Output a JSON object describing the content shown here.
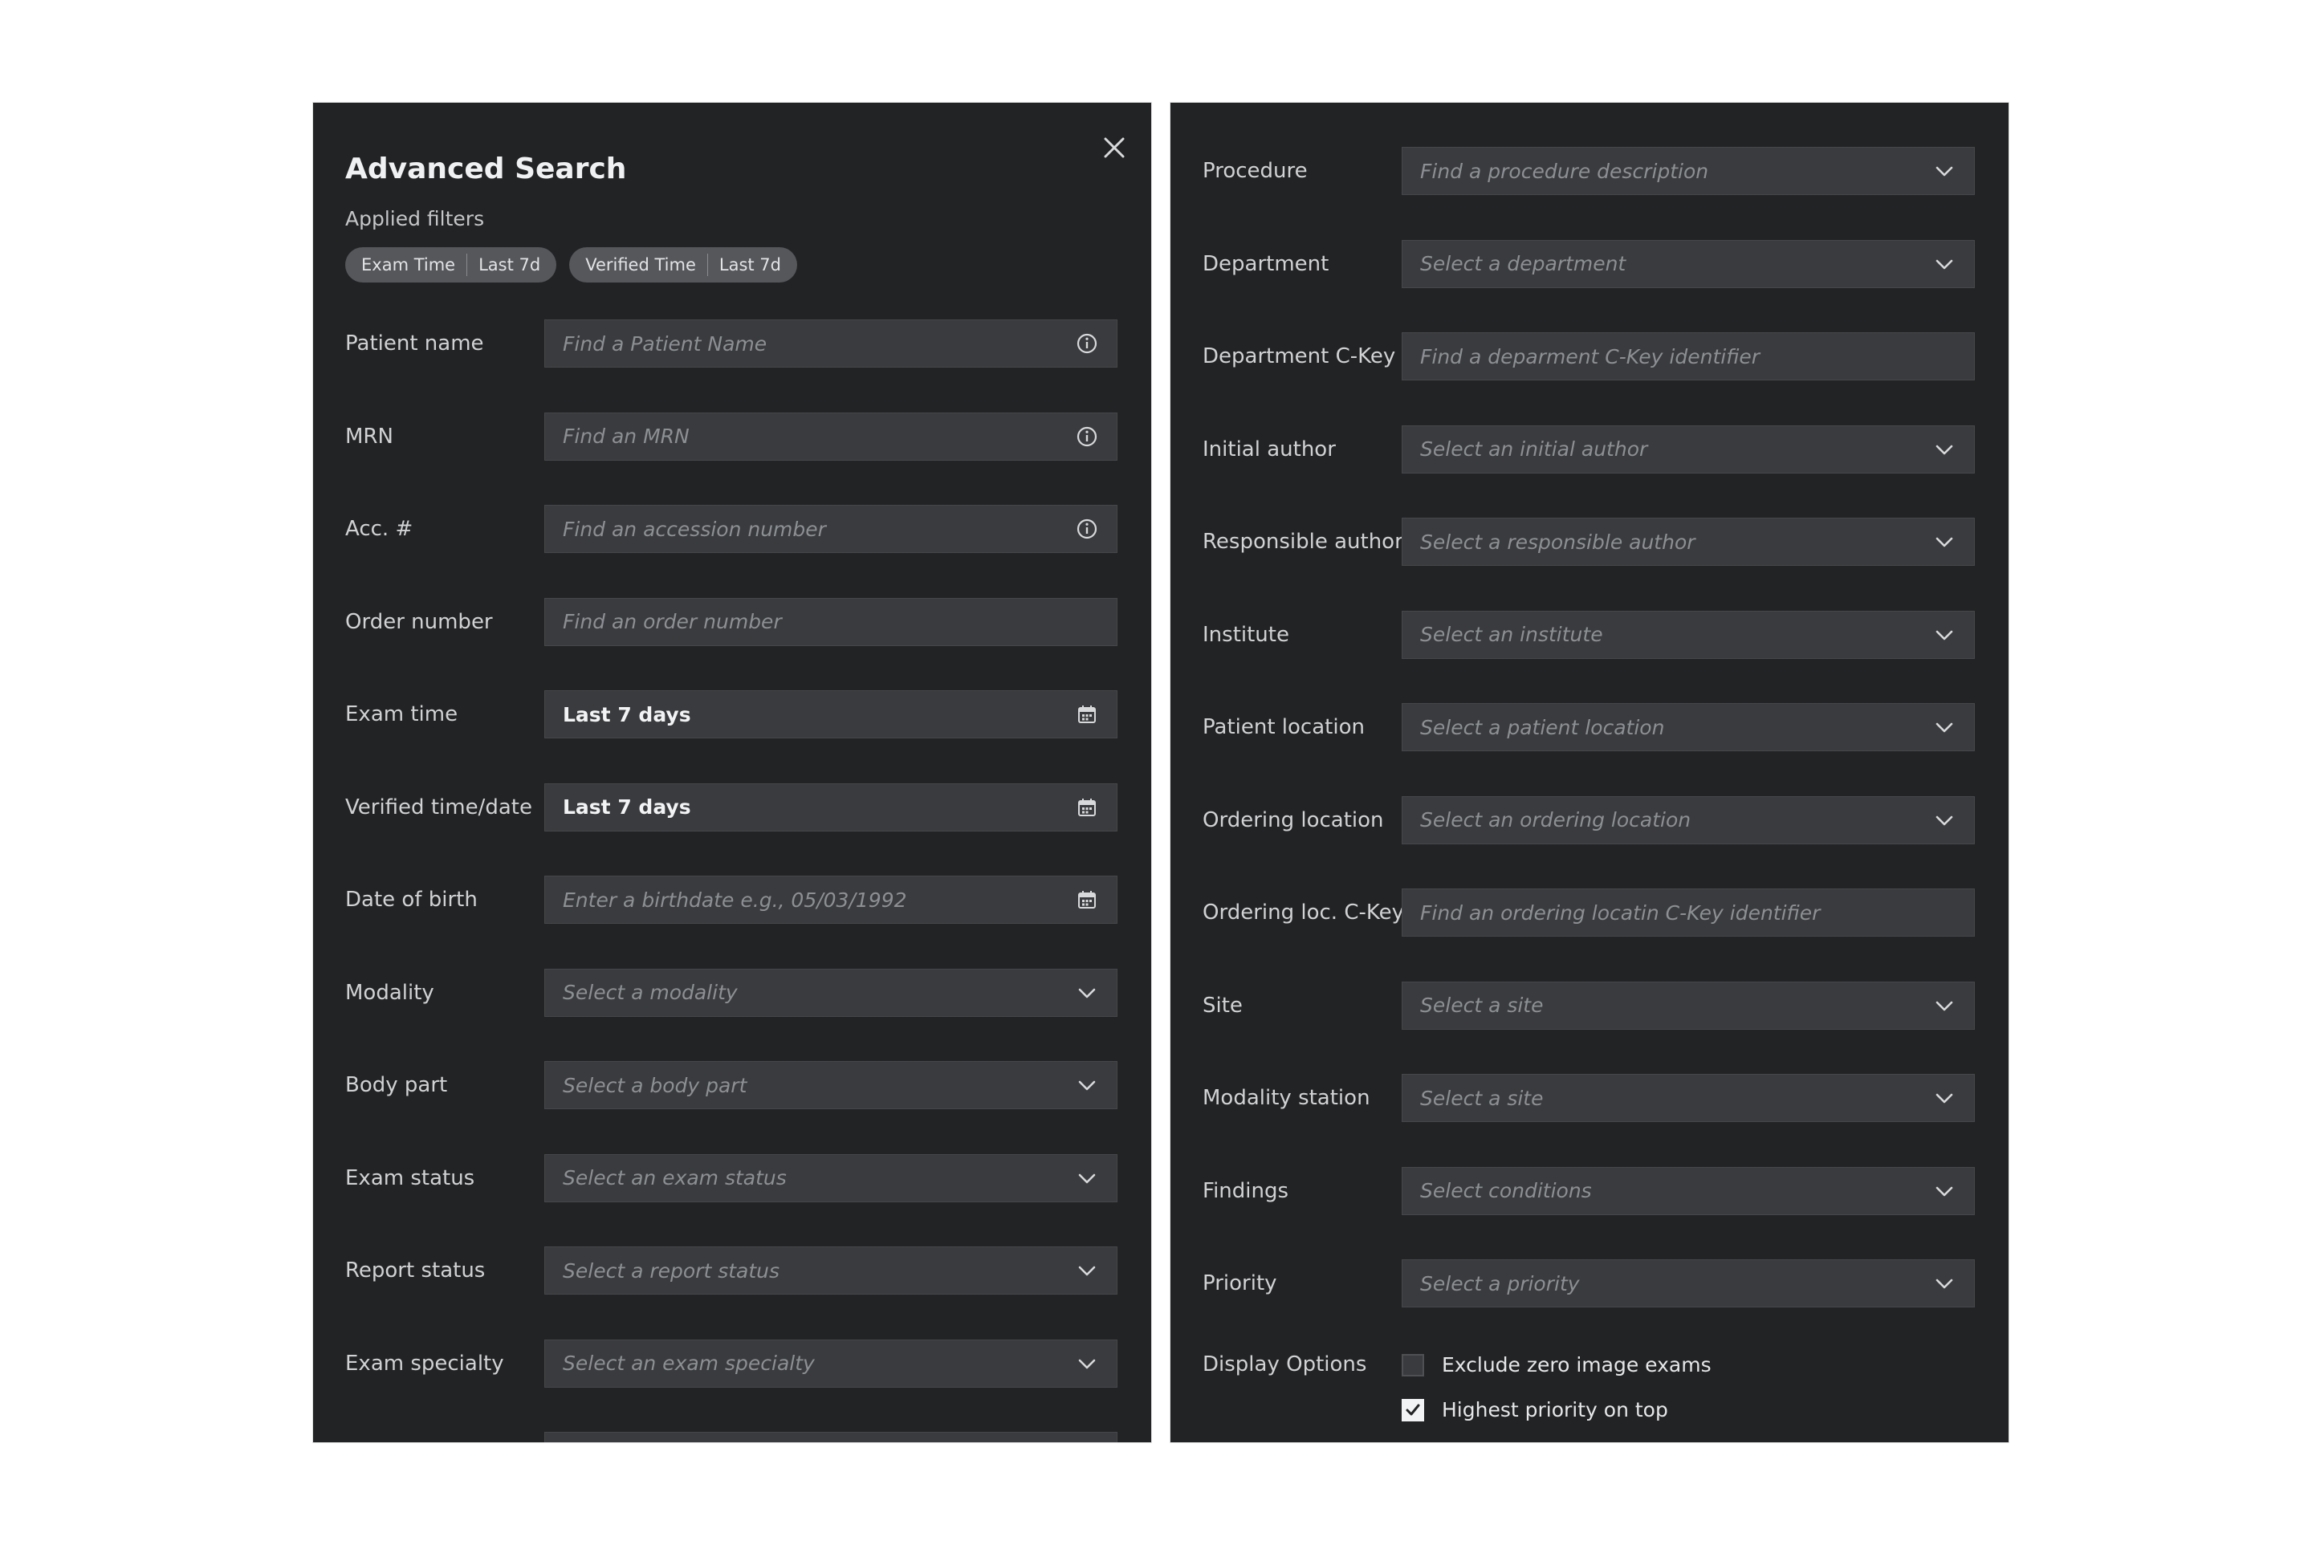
{
  "left_panel": {
    "title": "Advanced Search",
    "applied_filters_label": "Applied filters",
    "chips": [
      {
        "name": "Exam Time",
        "value": "Last 7d"
      },
      {
        "name": "Verified Time",
        "value": "Last 7d"
      }
    ],
    "fields": [
      {
        "label": "Patient name",
        "placeholder": "Find a Patient Name",
        "value": "",
        "icon": "info-icon"
      },
      {
        "label": "MRN",
        "placeholder": "Find an MRN",
        "value": "",
        "icon": "info-icon"
      },
      {
        "label": "Acc. #",
        "placeholder": "Find an accession number",
        "value": "",
        "icon": "info-icon"
      },
      {
        "label": "Order number",
        "placeholder": "Find an order number",
        "value": "",
        "icon": ""
      },
      {
        "label": "Exam time",
        "placeholder": "",
        "value": "Last 7 days",
        "icon": "calendar-icon"
      },
      {
        "label": "Verified time/date",
        "placeholder": "",
        "value": "Last 7 days",
        "icon": "calendar-icon"
      },
      {
        "label": "Date of birth",
        "placeholder": "Enter a birthdate e.g., 05/03/1992",
        "value": "",
        "icon": "calendar-icon"
      },
      {
        "label": "Modality",
        "placeholder": "Select a modality",
        "value": "",
        "icon": "chevron-down-icon"
      },
      {
        "label": "Body part",
        "placeholder": "Select a body part",
        "value": "",
        "icon": "chevron-down-icon"
      },
      {
        "label": "Exam status",
        "placeholder": "Select an exam status",
        "value": "",
        "icon": "chevron-down-icon"
      },
      {
        "label": "Report status",
        "placeholder": "Select a report status",
        "value": "",
        "icon": "chevron-down-icon"
      },
      {
        "label": "Exam specialty",
        "placeholder": "Select an exam specialty",
        "value": "",
        "icon": "chevron-down-icon"
      }
    ]
  },
  "right_panel": {
    "fields": [
      {
        "label": "Procedure",
        "placeholder": "Find a procedure description",
        "value": "",
        "icon": "chevron-down-icon"
      },
      {
        "label": "Department",
        "placeholder": "Select a department",
        "value": "",
        "icon": "chevron-down-icon"
      },
      {
        "label": "Department C-Key",
        "placeholder": "Find a deparment C-Key identifier",
        "value": "",
        "icon": ""
      },
      {
        "label": "Initial author",
        "placeholder": "Select an initial author",
        "value": "",
        "icon": "chevron-down-icon"
      },
      {
        "label": "Responsible author",
        "placeholder": "Select a responsible author",
        "value": "",
        "icon": "chevron-down-icon"
      },
      {
        "label": "Institute",
        "placeholder": "Select an institute",
        "value": "",
        "icon": "chevron-down-icon"
      },
      {
        "label": "Patient location",
        "placeholder": "Select a patient location",
        "value": "",
        "icon": "chevron-down-icon"
      },
      {
        "label": "Ordering location",
        "placeholder": "Select an ordering location",
        "value": "",
        "icon": "chevron-down-icon"
      },
      {
        "label": "Ordering loc. C-Key",
        "placeholder": "Find an ordering locatin C-Key identifier",
        "value": "",
        "icon": ""
      },
      {
        "label": "Site",
        "placeholder": "Select a site",
        "value": "",
        "icon": "chevron-down-icon"
      },
      {
        "label": "Modality station",
        "placeholder": "Select a site",
        "value": "",
        "icon": "chevron-down-icon"
      },
      {
        "label": "Findings",
        "placeholder": "Select conditions",
        "value": "",
        "icon": "chevron-down-icon"
      },
      {
        "label": "Priority",
        "placeholder": "Select a priority",
        "value": "",
        "icon": "chevron-down-icon"
      }
    ],
    "display_options": {
      "label": "Display Options",
      "options": [
        {
          "label": "Exclude zero image exams",
          "checked": false
        },
        {
          "label": "Highest priority on top",
          "checked": true
        }
      ]
    }
  },
  "colors": {
    "panel_bg": "#222325",
    "field_bg": "#3a3b3e",
    "chip_bg": "#55575b",
    "page_bg": "#ffffff"
  }
}
